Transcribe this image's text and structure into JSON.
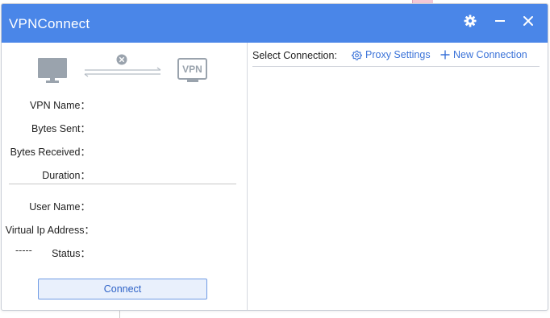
{
  "window": {
    "title": "VPNConnect",
    "controls": {
      "settings": "gear-icon",
      "minimize": "minimize-icon",
      "close": "close-icon"
    },
    "accent_color": "#4a86e8"
  },
  "status_panel": {
    "diagram": {
      "computer": "computer-icon",
      "link_state": "disconnected-icon",
      "vpn_badge": "VPN"
    },
    "fields": [
      {
        "label": "VPN Name：",
        "value": ""
      },
      {
        "label": "Bytes Sent：",
        "value": ""
      },
      {
        "label": "Bytes Received：",
        "value": ""
      },
      {
        "label": "Duration：",
        "value": ""
      }
    ],
    "fields2": [
      {
        "label": "User Name：",
        "value": ""
      },
      {
        "label": "Virtual Ip Address：",
        "value": ""
      },
      {
        "label": "Status：",
        "value": "-----"
      }
    ],
    "connect_label": "Connect"
  },
  "connections": {
    "select_label": "Select Connection:",
    "proxy_settings_label": "Proxy Settings",
    "new_connection_label": "New Connection",
    "items": []
  }
}
